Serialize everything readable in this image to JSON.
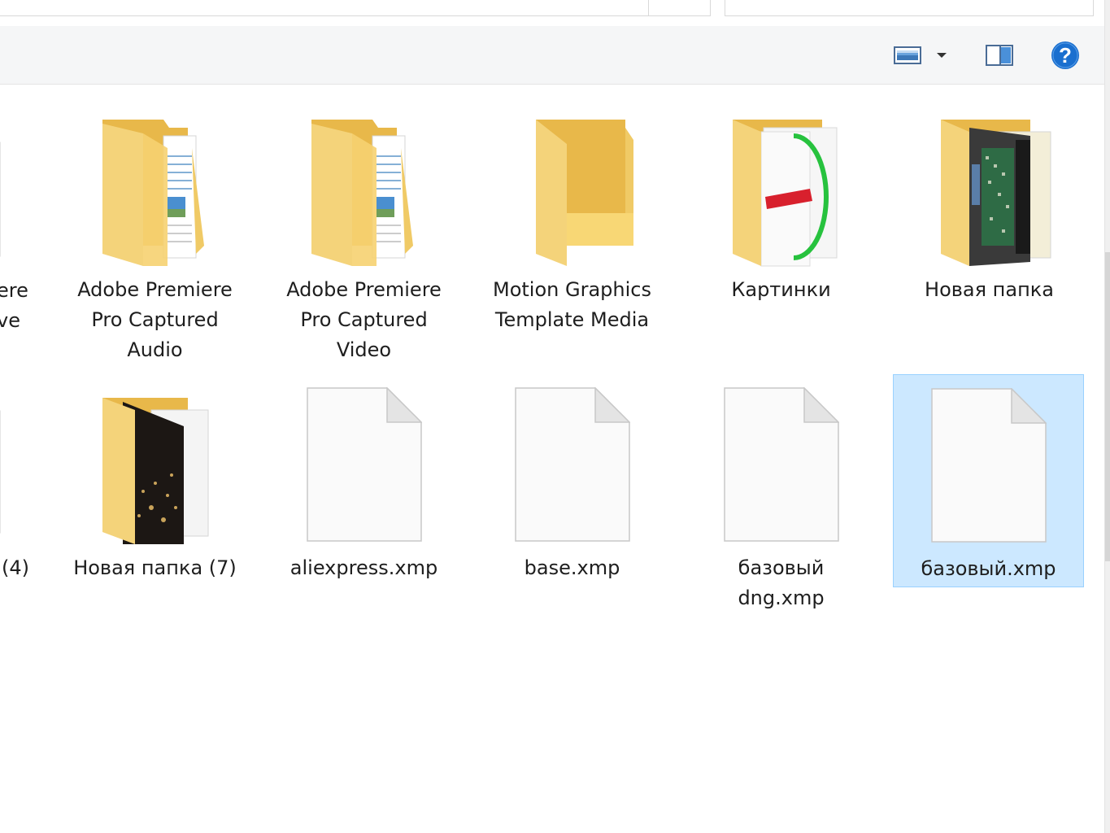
{
  "toolbar": {
    "view_icon": "view-options-icon",
    "dropdown_icon": "chevron-down-icon",
    "preview_pane_icon": "preview-pane-icon",
    "help_icon": "help-icon",
    "help_label": "?"
  },
  "partial_column": {
    "row1_label": "ere\nve",
    "row2_label": "(4)"
  },
  "items": [
    {
      "name": "Adobe Premiere\nPro Captured\nAudio",
      "type": "folder-with-docs"
    },
    {
      "name": "Adobe Premiere\nPro Captured\nVideo",
      "type": "folder-with-docs"
    },
    {
      "name": "Motion Graphics\nTemplate Media",
      "type": "folder-empty"
    },
    {
      "name": "Картинки",
      "type": "folder-with-image"
    },
    {
      "name": "Новая папка",
      "type": "folder-with-photo"
    },
    {
      "name": "Новая папка (7)",
      "type": "folder-with-night-photo"
    },
    {
      "name": "aliexpress.xmp",
      "type": "file"
    },
    {
      "name": "base.xmp",
      "type": "file"
    },
    {
      "name": "базовый\ndng.xmp",
      "type": "file"
    },
    {
      "name": "базовый.xmp",
      "type": "file",
      "selected": true
    }
  ],
  "colors": {
    "folder_front": "#f8d775",
    "folder_back": "#e8b84a",
    "selection_bg": "#cce8ff",
    "selection_border": "#99d1ff",
    "help_blue": "#1a6fcf"
  }
}
